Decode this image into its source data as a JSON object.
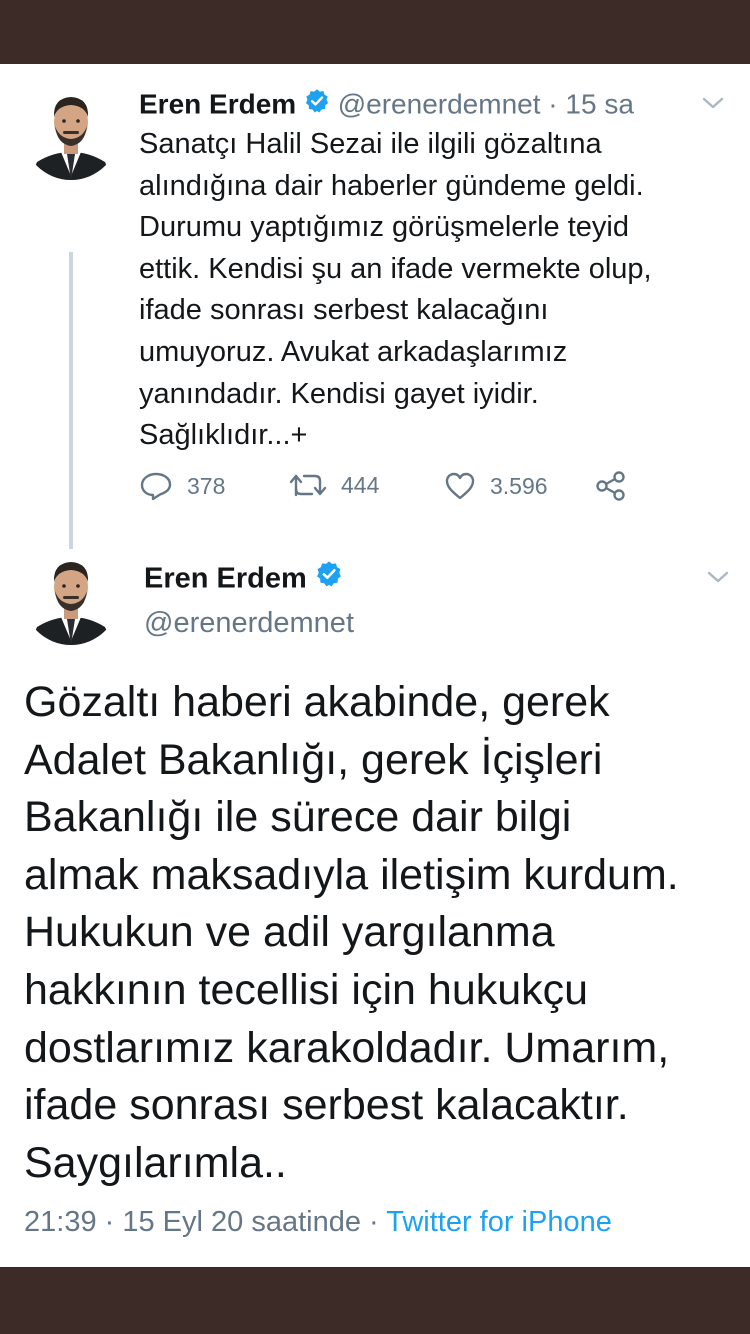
{
  "colors": {
    "frame": "#3d2b28",
    "card": "#ffffff",
    "text": "#14171a",
    "muted": "#657786",
    "link": "#1da1f2",
    "verified": "#1da1f2",
    "thread_line": "#ccd6dd"
  },
  "tweet1": {
    "name": "Eren Erdem",
    "handle": "@erenerdemnet",
    "time_sep": " · ",
    "time": "15 sa",
    "text": "Sanatçı Halil Sezai ile ilgili gözaltına\nalındığına dair haberler gündeme geldi.\nDurumu yaptığımız görüşmelerle teyid\nettik. Kendisi şu an ifade vermekte olup,\nifade sonrası serbest kalacağını\numuyoruz. Avukat arkadaşlarımız\nyanındadır. Kendisi gayet iyidir.\nSağlıklıdır...+",
    "replies": "378",
    "retweets": "444",
    "likes": "3.596",
    "icons": [
      "avatar",
      "verified-badge-icon",
      "chevron-down-icon",
      "reply-icon",
      "retweet-icon",
      "like-icon",
      "share-icon"
    ]
  },
  "tweet2": {
    "name": "Eren Erdem",
    "handle": "@erenerdemnet",
    "text": "Gözaltı haberi akabinde, gerek\nAdalet Bakanlığı, gerek İçişleri\nBakanlığı ile sürece dair bilgi\nalmak maksadıyla iletişim kurdum.\nHukukun ve adil yargılanma\nhakkının tecellisi için hukukçu\ndostlarımız karakoldadır. Umarım,\nifade sonrası serbest kalacaktır.\nSaygılarımla..",
    "timestamp": "21:39 · 15 Eyl 20 saatinde · ",
    "source": "Twitter for iPhone"
  }
}
